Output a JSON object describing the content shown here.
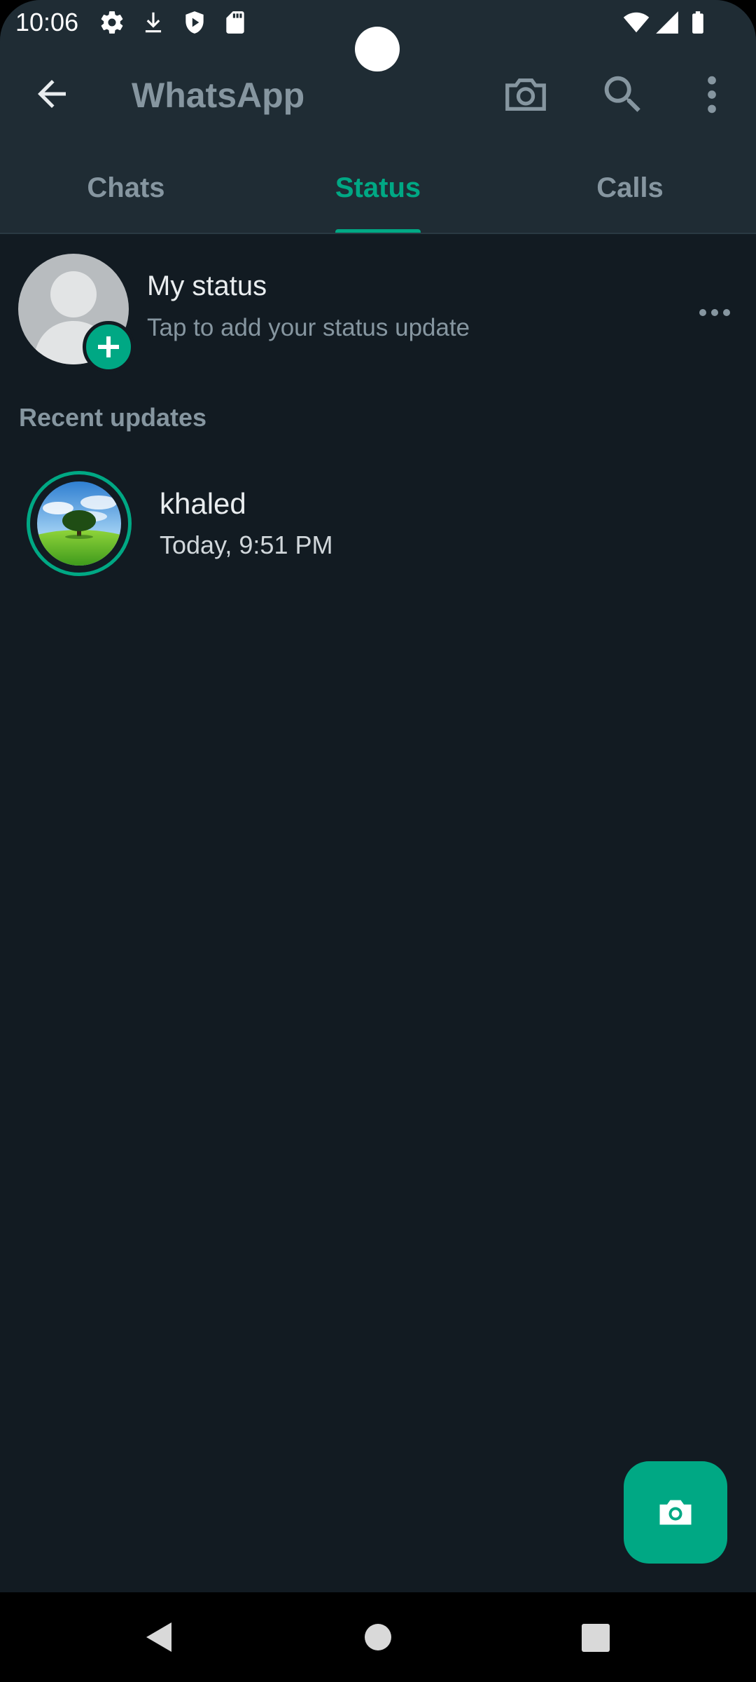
{
  "status_bar": {
    "time": "10:06",
    "left_icons": [
      "gear-icon",
      "download-icon",
      "shield-icon",
      "sd-card-icon"
    ],
    "right_icons": [
      "wifi-icon",
      "cell-signal-icon",
      "battery-icon"
    ]
  },
  "app_bar": {
    "title": "WhatsApp",
    "icons": [
      "back-arrow-icon",
      "camera-icon",
      "search-icon",
      "overflow-menu-icon"
    ]
  },
  "tabs": [
    {
      "label": "Chats",
      "active": false
    },
    {
      "label": "Status",
      "active": true
    },
    {
      "label": "Calls",
      "active": false
    }
  ],
  "my_status": {
    "title": "My status",
    "subtitle": "Tap to add your status update"
  },
  "recent_updates": {
    "header": "Recent updates",
    "items": [
      {
        "name": "khaled",
        "time": "Today, 9:51 PM"
      }
    ]
  },
  "fab": {
    "icon": "camera-icon"
  },
  "nav_bar": {
    "icons": [
      "back-triangle-icon",
      "home-circle-icon",
      "recents-square-icon"
    ]
  },
  "colors": {
    "accent": "#00a884",
    "background": "#121b22",
    "app_bar": "#1f2c34",
    "secondary_text": "#8696a0",
    "primary_text": "#e9edef"
  }
}
